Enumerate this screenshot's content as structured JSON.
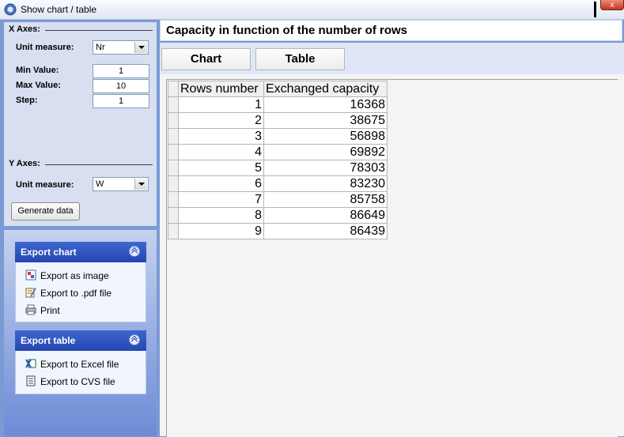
{
  "window": {
    "title": "Show chart / table",
    "close_label": "x"
  },
  "x_axes": {
    "heading": "X Axes:",
    "unit_label": "Unit measure:",
    "unit_value": "Nr",
    "min_label": "Min Value:",
    "min_value": "1",
    "max_label": "Max Value:",
    "max_value": "10",
    "step_label": "Step:",
    "step_value": "1"
  },
  "y_axes": {
    "heading": "Y Axes:",
    "unit_label": "Unit measure:",
    "unit_value": "W"
  },
  "generate_label": "Generate data",
  "export_chart": {
    "title": "Export chart",
    "items": [
      "Export as image",
      "Export to .pdf file",
      "Print"
    ]
  },
  "export_table": {
    "title": "Export table",
    "items": [
      "Export to Excel file",
      "Export to CVS file"
    ]
  },
  "main": {
    "title": "Capacity in function of the number of rows",
    "tabs": [
      "Chart",
      "Table"
    ]
  },
  "table": {
    "columns": [
      "Rows number",
      "Exchanged capacity"
    ],
    "rows": [
      [
        "1",
        "16368"
      ],
      [
        "2",
        "38675"
      ],
      [
        "3",
        "56898"
      ],
      [
        "4",
        "69892"
      ],
      [
        "5",
        "78303"
      ],
      [
        "6",
        "83230"
      ],
      [
        "7",
        "85758"
      ],
      [
        "8",
        "86649"
      ],
      [
        "9",
        "86439"
      ]
    ]
  }
}
